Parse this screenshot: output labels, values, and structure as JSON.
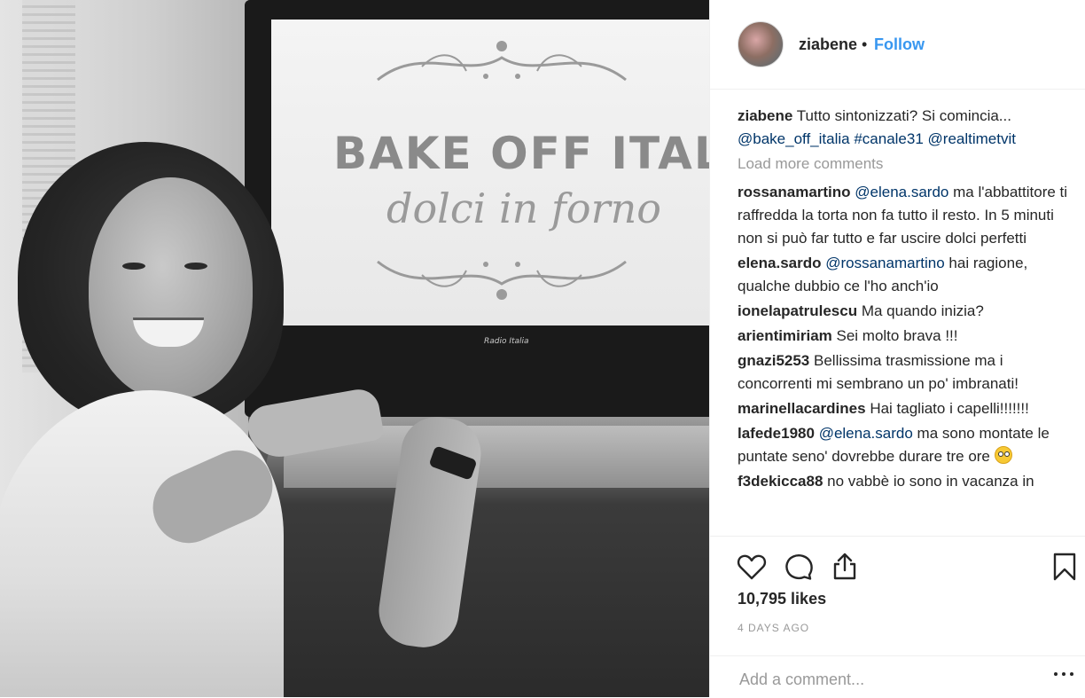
{
  "photo": {
    "show_title": "BAKE OFF ITALIA",
    "show_subtitle": "dolci in forno",
    "tv_brand": "Radio Italia"
  },
  "post": {
    "username": "ziabene",
    "separator": "•",
    "follow_label": "Follow",
    "caption": {
      "user": "ziabene",
      "text": "Tutto sintonizzati? Si comincia...",
      "mention": "@bake_off_italia",
      "tag": "#canale31",
      "mention2": "@realtimetvit"
    },
    "load_more_label": "Load more comments",
    "comments": [
      {
        "user": "rossanamartino",
        "mention": "@elena.sardo",
        "text": "ma l'abbattitore ti raffredda la torta non fa tutto il resto. In 5 minuti non si può far tutto e far uscire dolci perfetti"
      },
      {
        "user": "elena.sardo",
        "mention": "@rossanamartino",
        "text": "hai ragione, qualche dubbio ce l'ho anch'io"
      },
      {
        "user": "ionelapatrulescu",
        "mention": "",
        "text": "Ma quando inizia?"
      },
      {
        "user": "arientimiriam",
        "mention": "",
        "text": "Sei molto brava !!!"
      },
      {
        "user": "gnazi5253",
        "mention": "",
        "text": "Bellissima trasmissione ma i concorrenti mi sembrano un po' imbranati!"
      },
      {
        "user": "marinellacardines",
        "mention": "",
        "text": "Hai tagliato i capelli!!!!!!!"
      },
      {
        "user": "lafede1980",
        "mention": "@elena.sardo",
        "text": "ma sono montate le puntate seno' dovrebbe durare tre ore"
      },
      {
        "user": "f3dekicca88",
        "mention": "",
        "text": "no vabbè io sono in vacanza in"
      }
    ],
    "likes": "10,795 likes",
    "timestamp": "4 DAYS AGO",
    "add_comment_placeholder": "Add a comment..."
  },
  "icons": {
    "like": "heart-icon",
    "comment": "speech-bubble-icon",
    "share": "share-icon",
    "save": "bookmark-icon",
    "more": "more-options-icon",
    "emoji": "face-with-rolling-eyes-emoji"
  },
  "colors": {
    "link_blue": "#3897f0",
    "mention_navy": "#003569",
    "muted_gray": "#999999",
    "text": "#262626",
    "divider": "#efefef"
  }
}
